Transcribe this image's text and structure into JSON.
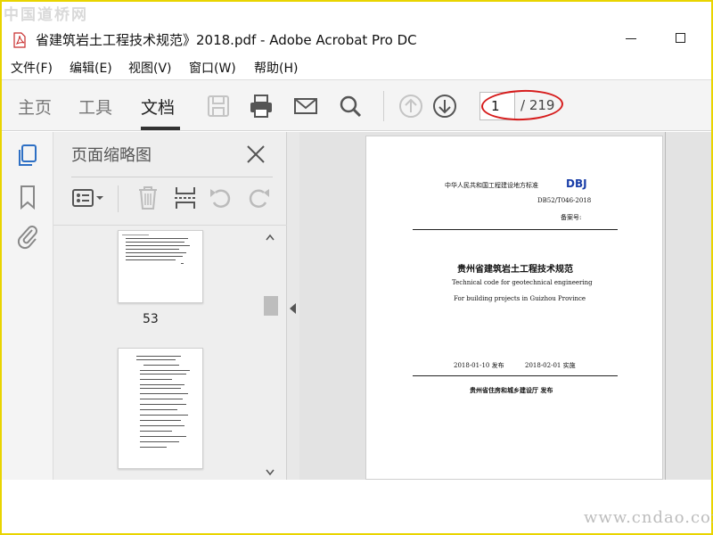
{
  "watermark_top": "中国道桥网",
  "watermark_bottom": "www.cndao.com",
  "window": {
    "title": "省建筑岩土工程技术规范》2018.pdf - Adobe Acrobat Pro DC",
    "icon": "pdf-file-icon",
    "accent_color": "#e9d400"
  },
  "menu": [
    "文件(F)",
    "编辑(E)",
    "视图(V)",
    "窗口(W)",
    "帮助(H)"
  ],
  "toolbar": {
    "tabs": [
      "主页",
      "工具",
      "文档"
    ],
    "active_tab": "文档",
    "icons": [
      "save-icon",
      "print-icon",
      "email-icon",
      "search-icon",
      "page-up-icon",
      "page-down-icon"
    ],
    "page_current": "1",
    "page_total": "/ 219"
  },
  "left_rail": {
    "icons": [
      "page-thumbnails-icon",
      "bookmark-icon",
      "attachment-icon"
    ]
  },
  "thumbnails_panel": {
    "title": "页面缩略图",
    "tools": [
      "thumbnail-options-icon",
      "delete-page-icon",
      "extract-page-icon",
      "rotate-ccw-icon",
      "rotate-cw-icon"
    ],
    "page_label": "53"
  },
  "document": {
    "header_left": "中华人民共和国工程建设地方标准",
    "header_right": "DBJ",
    "code": "DB52/T046-2018",
    "record": "备案号:",
    "title_cn": "贵州省建筑岩土工程技术规范",
    "title_en_1": "Technical code for geotechnical engineering",
    "title_en_2": "For building projects in Guizhou Province",
    "issued": "2018-01-10  发布",
    "effective": "2018-02-01  实施",
    "publisher": "贵州省住房和城乡建设厅  发布",
    "brand_color": "#1a3ea8"
  }
}
